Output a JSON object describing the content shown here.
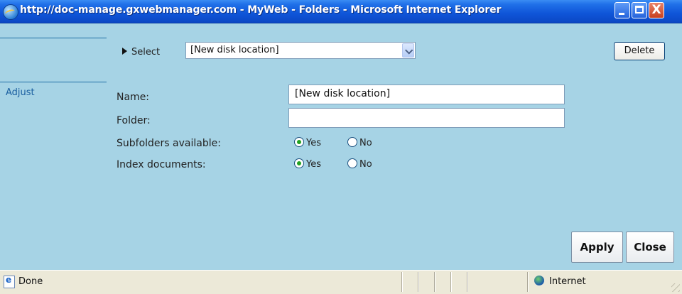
{
  "window": {
    "title": "http://doc-manage.gxwebmanager.com - MyWeb - Folders - Microsoft Internet Explorer",
    "close_glyph": "X"
  },
  "sidebar": {
    "items": [
      {
        "label": "Adjust"
      }
    ]
  },
  "toolbar": {
    "select_label": "Select",
    "select_value": "[New disk location]",
    "delete_label": "Delete"
  },
  "form": {
    "name_label": "Name:",
    "name_value": "[New disk location]",
    "folder_label": "Folder:",
    "folder_value": "",
    "subfolders_label": "Subfolders available:",
    "index_label": "Index documents:",
    "yes_label": "Yes",
    "no_label": "No",
    "subfolders_selected": "Yes",
    "index_selected": "Yes"
  },
  "actions": {
    "apply_label": "Apply",
    "close_label": "Close"
  },
  "status": {
    "text": "Done",
    "zone": "Internet"
  },
  "colors": {
    "background": "#a6d3e5",
    "title_bar": "#0f55d8",
    "status_bar": "#ece9d8"
  }
}
